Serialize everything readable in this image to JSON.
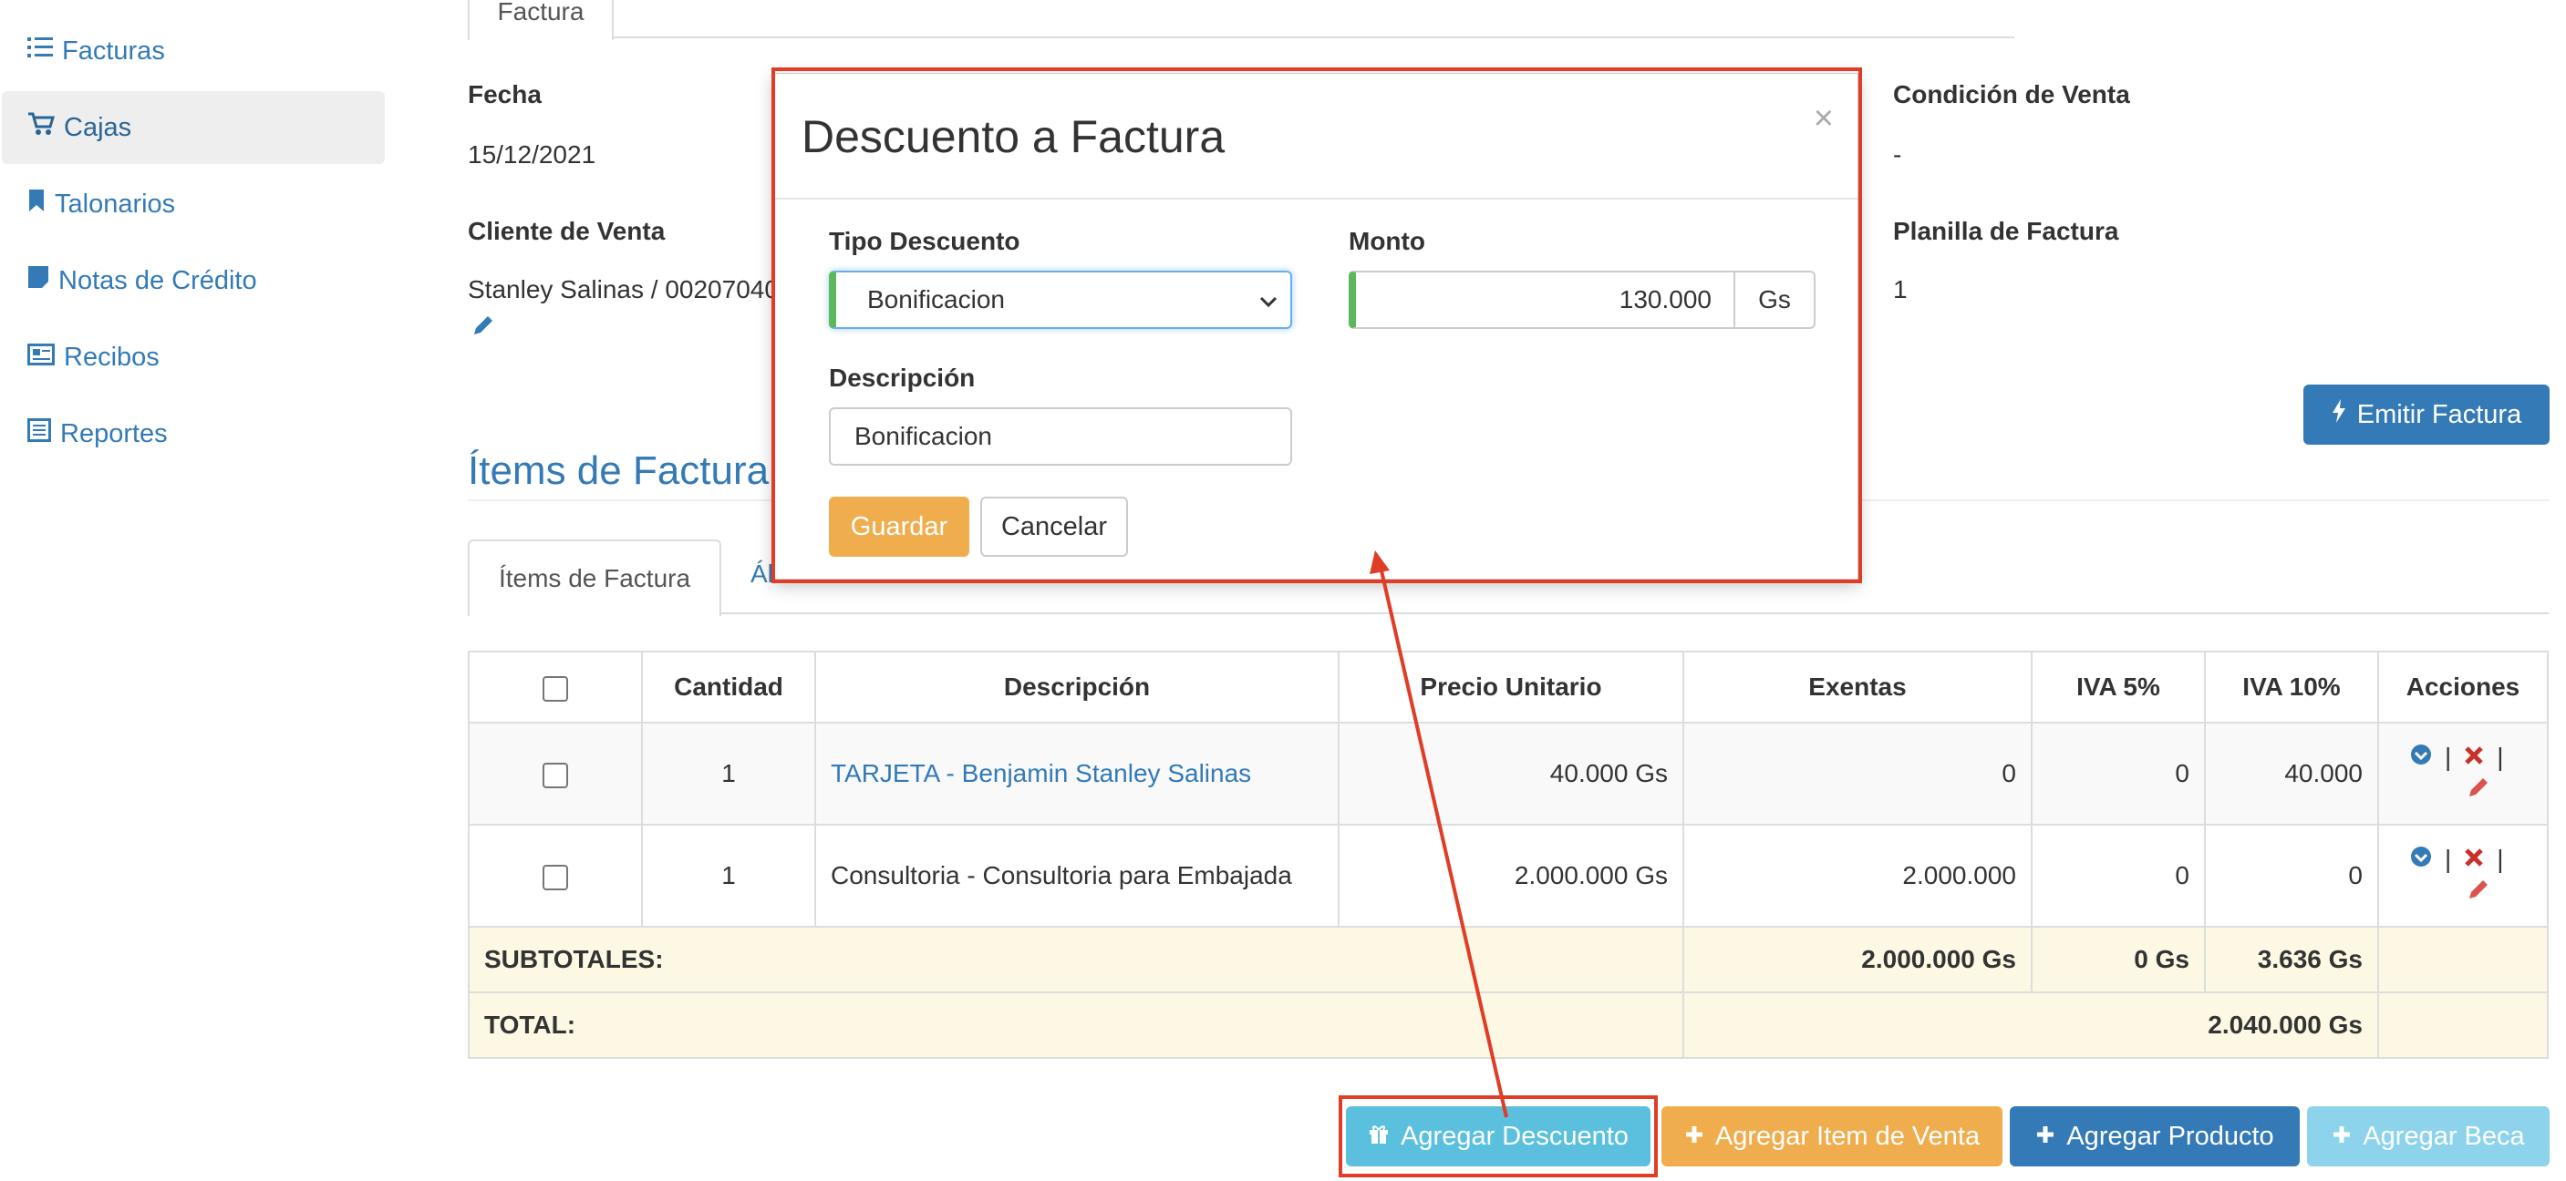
{
  "sidebar": {
    "items": [
      {
        "label": "Facturas",
        "icon": "list-icon"
      },
      {
        "label": "Cajas",
        "icon": "cart-icon"
      },
      {
        "label": "Talonarios",
        "icon": "bookmark-icon"
      },
      {
        "label": "Notas de Crédito",
        "icon": "note-icon"
      },
      {
        "label": "Recibos",
        "icon": "receipt-icon"
      },
      {
        "label": "Reportes",
        "icon": "report-icon"
      }
    ]
  },
  "top_tab": {
    "label": "Factura"
  },
  "invoice": {
    "fecha_label": "Fecha",
    "fecha_value": "15/12/2021",
    "cliente_label": "Cliente de Venta",
    "cliente_value": "Stanley Salinas / 00207040",
    "condicion_label": "Condición de Venta",
    "condicion_value": "-",
    "planilla_label": "Planilla de Factura",
    "planilla_value": "1",
    "emit_button": "Emitir Factura"
  },
  "items_section": {
    "title": "Ítems de Factura",
    "tabs": [
      "Ítems de Factura",
      "Álbumes"
    ]
  },
  "table": {
    "headers": [
      "Cantidad",
      "Descripción",
      "Precio Unitario",
      "Exentas",
      "IVA 5%",
      "IVA 10%",
      "Acciones"
    ],
    "rows": [
      {
        "cantidad": "1",
        "descripcion": "TARJETA - Benjamin Stanley Salinas",
        "precio": "40.000 Gs",
        "exentas": "0",
        "iva5": "0",
        "iva10": "40.000"
      },
      {
        "cantidad": "1",
        "descripcion": "Consultoria - Consultoria para Embajada",
        "precio": "2.000.000 Gs",
        "exentas": "2.000.000",
        "iva5": "0",
        "iva10": "0"
      }
    ],
    "subtotal_label": "SUBTOTALES:",
    "subtotal_exentas": "2.000.000 Gs",
    "subtotal_iva5": "0 Gs",
    "subtotal_iva10": "3.636 Gs",
    "total_label": "TOTAL:",
    "total_value": "2.040.000 Gs",
    "action_sep": "|"
  },
  "bottom_buttons": {
    "descuento": "Agregar Descuento",
    "item_venta": "Agregar Item de Venta",
    "producto": "Agregar Producto",
    "beca": "Agregar Beca"
  },
  "modal": {
    "title": "Descuento a Factura",
    "close": "×",
    "tipo_label": "Tipo Descuento",
    "tipo_options": [
      "Bonificacion"
    ],
    "monto_label": "Monto",
    "monto_value": "130.000",
    "monto_unit": "Gs",
    "descripcion_label": "Descripción",
    "descripcion_value": "Bonificacion",
    "save_button": "Guardar",
    "cancel_button": "Cancelar"
  },
  "colors": {
    "primary": "#337ab7",
    "warning": "#f0ad4e",
    "info": "#5bc0de",
    "danger": "#d9534f",
    "success": "#5cb85c",
    "annotation": "#e03c26"
  }
}
